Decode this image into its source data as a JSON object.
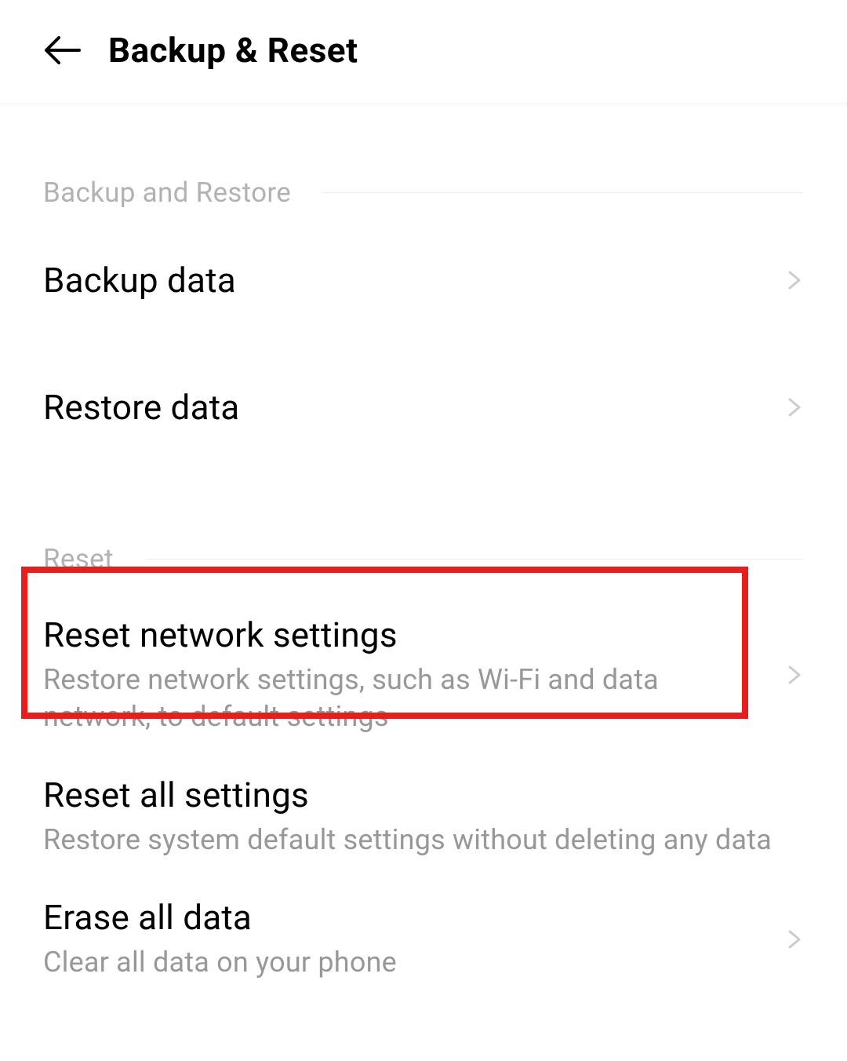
{
  "header": {
    "title": "Backup & Reset"
  },
  "sections": {
    "backup_restore": {
      "label": "Backup and Restore",
      "items": [
        {
          "title": "Backup data"
        },
        {
          "title": "Restore data"
        }
      ]
    },
    "reset": {
      "label": "Reset",
      "items": [
        {
          "title": "Reset network settings",
          "subtitle": "Restore network settings, such as Wi-Fi and data network, to default settings"
        },
        {
          "title": "Reset all settings",
          "subtitle": "Restore system default settings without deleting any data"
        },
        {
          "title": "Erase all data",
          "subtitle": "Clear all data on your phone"
        }
      ]
    }
  }
}
